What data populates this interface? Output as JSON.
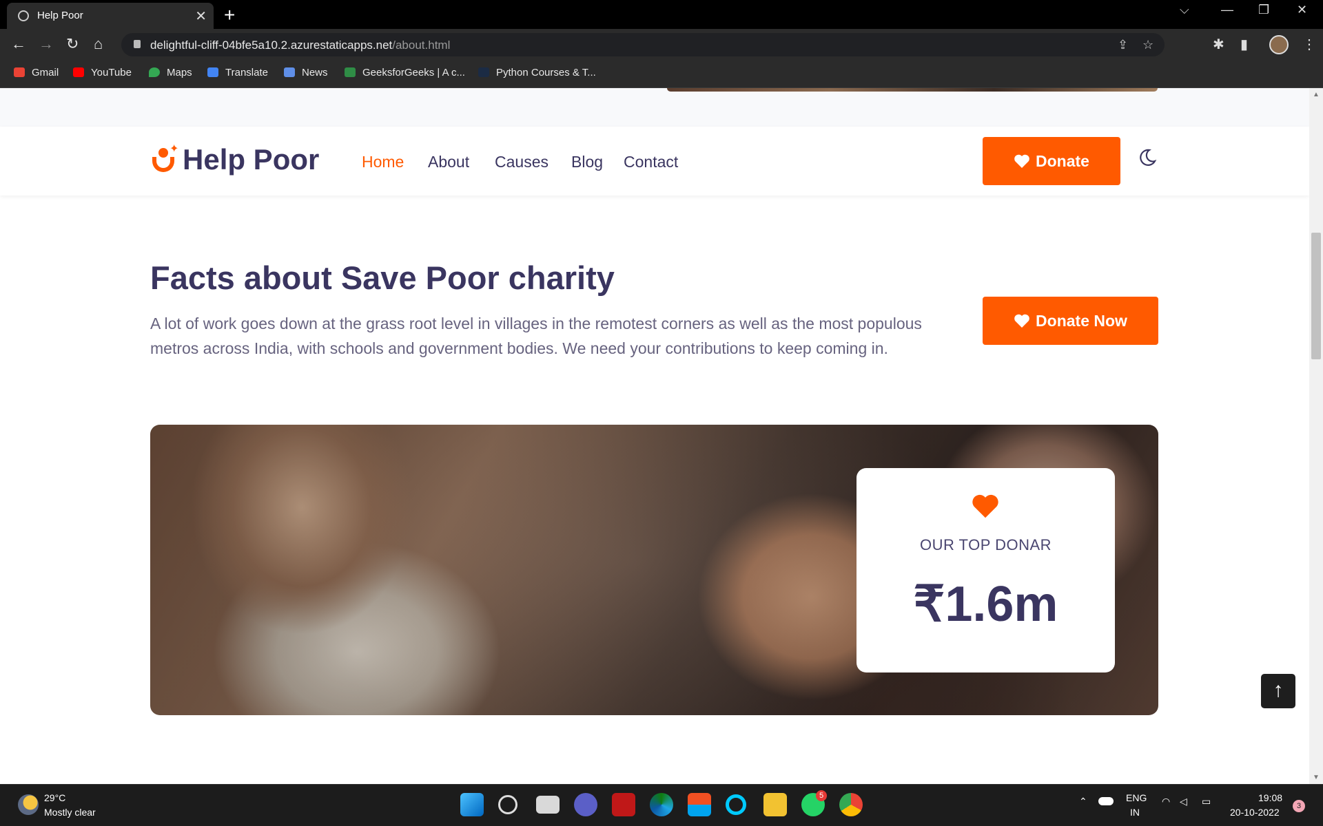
{
  "browser": {
    "tab_title": "Help Poor",
    "tab_close": "✕",
    "new_tab": "+",
    "url_host": "delightful-cliff-04bfe5a10.2.azurestaticapps.net",
    "url_path": "/about.html",
    "bookmarks": [
      "Gmail",
      "YouTube",
      "Maps",
      "Translate",
      "News",
      "GeeksforGeeks | A c...",
      "Python Courses & T..."
    ]
  },
  "site": {
    "brand": "Help Poor",
    "nav": [
      "Home",
      "About",
      "Causes",
      "Blog",
      "Contact"
    ],
    "donate_label": "Donate",
    "section_title": "Facts about Save Poor charity",
    "section_desc": "A lot of work goes down at the grass root level in villages in the remotest corners as well as the most populous metros across India, with schools and government bodies. We need your contributions to keep coming in.",
    "donate_now_label": "Donate Now",
    "donor_label": "OUR TOP DONAR",
    "donor_amount": "₹1.6m",
    "accent_color": "#ff5a00",
    "text_color": "#3a3560"
  },
  "taskbar": {
    "temperature": "29°C",
    "weather": "Mostly clear",
    "lang_top": "ENG",
    "lang_bottom": "IN",
    "time": "19:08",
    "date": "20-10-2022",
    "whatsapp_badge": "5",
    "notif_badge": "3"
  }
}
